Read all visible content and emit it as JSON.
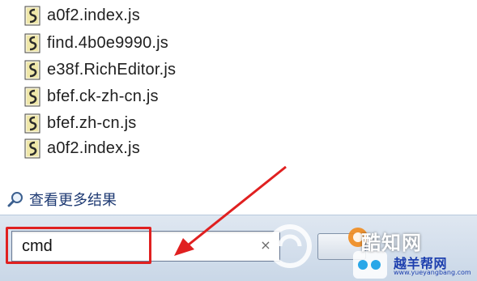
{
  "results": {
    "files": [
      {
        "name": "a0f2.index.js",
        "icon": "js-file-icon"
      },
      {
        "name": "find.4b0e9990.js",
        "icon": "js-file-icon"
      },
      {
        "name": "e38f.RichEditor.js",
        "icon": "js-file-icon"
      },
      {
        "name": "bfef.ck-zh-cn.js",
        "icon": "js-file-icon"
      },
      {
        "name": "bfef.zh-cn.js",
        "icon": "js-file-icon"
      },
      {
        "name": "a0f2.index.js",
        "icon": "js-file-icon"
      }
    ],
    "see_more_label": "查看更多结果"
  },
  "search": {
    "value": "cmd",
    "clear_glyph": "×"
  },
  "watermark": {
    "brand": "酷知网",
    "site": "越羊帮网",
    "url": "www.yueyangbang.com"
  },
  "colors": {
    "highlight": "#e02020",
    "arrow": "#e02020",
    "link": "#1e3a73",
    "bar": "#d3deeb"
  }
}
